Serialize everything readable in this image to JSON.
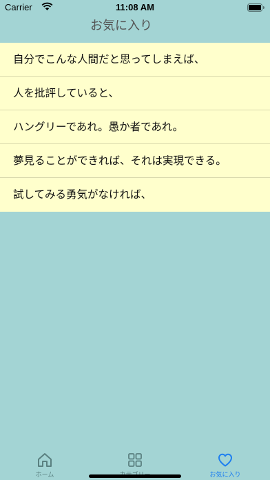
{
  "status_bar": {
    "carrier": "Carrier",
    "time": "11:08 AM"
  },
  "nav": {
    "title": "お気に入り"
  },
  "favorites": [
    "自分でこんな人間だと思ってしまえば、",
    "人を批評していると、",
    "ハングリーであれ。愚か者であれ。",
    "夢見ることができれば、それは実現できる。",
    "試してみる勇気がなければ、"
  ],
  "tabs": [
    {
      "label": "ホーム",
      "icon": "home-icon"
    },
    {
      "label": "カテゴリー",
      "icon": "grid-icon"
    },
    {
      "label": "お気に入り",
      "icon": "heart-icon"
    }
  ],
  "colors": {
    "background": "#a3d4d4",
    "list_background": "#ffffcc",
    "tab_active": "#1e7ff0",
    "tab_inactive": "#5a8080"
  }
}
